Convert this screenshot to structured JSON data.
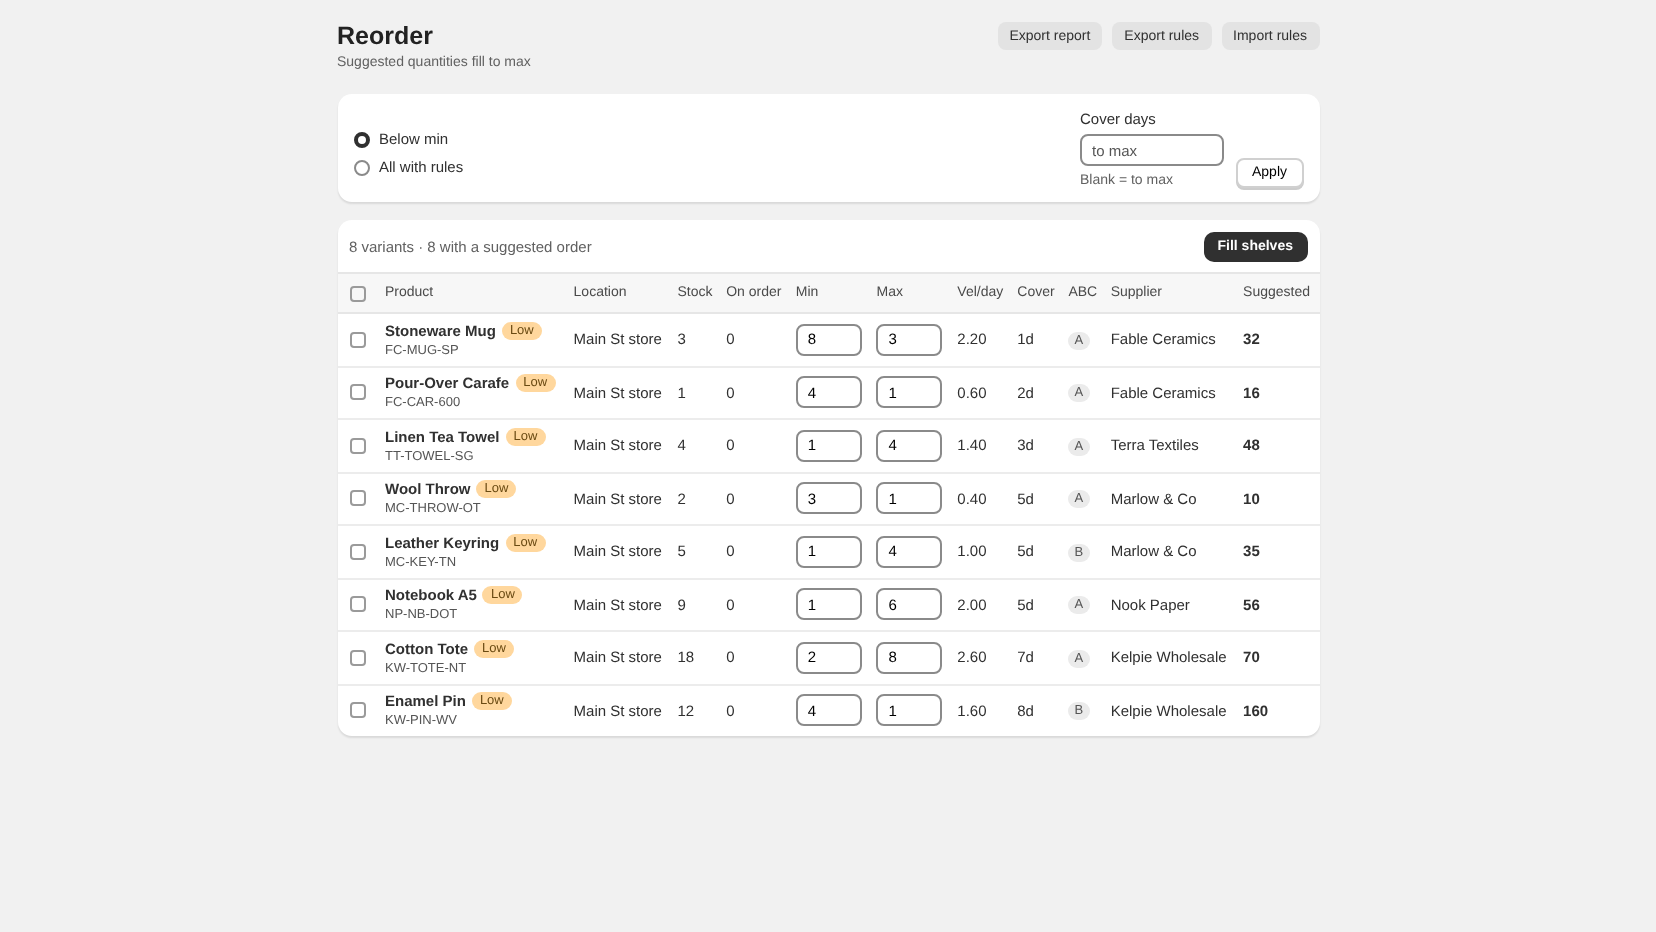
{
  "page": {
    "title": "Reorder",
    "subtitle": "Suggested quantities fill to max",
    "actions": [
      "Export report",
      "Export rules",
      "Import rules"
    ]
  },
  "filter": {
    "options": [
      {
        "label": "Below min",
        "selected": true
      },
      {
        "label": "All with rules",
        "selected": false
      }
    ],
    "cover_days": {
      "label": "Cover days",
      "placeholder": "to max",
      "help": "Blank = to max"
    },
    "apply": "Apply"
  },
  "table": {
    "summary": "8 variants · 8 with a suggested order",
    "fill_button": "Fill shelves",
    "select_all_checked": false,
    "columns": [
      "Product",
      "Location",
      "Stock",
      "On order",
      "Min",
      "Max",
      "Vel/day",
      "Cover",
      "ABC",
      "Supplier",
      "Suggested"
    ],
    "rows": [
      {
        "checked": false,
        "product": "Stoneware Mug",
        "badge": "Low",
        "sku": "FC-MUG-SP",
        "location": "Main St store",
        "stock": "3",
        "on_order": "0",
        "min": "8",
        "max": "3",
        "vel": "2.20",
        "cover": "1d",
        "abc": "A",
        "supplier": "Fable Ceramics",
        "suggested": "32"
      },
      {
        "checked": false,
        "product": "Pour-Over Carafe",
        "badge": "Low",
        "sku": "FC-CAR-600",
        "location": "Main St store",
        "stock": "1",
        "on_order": "0",
        "min": "4",
        "max": "1",
        "vel": "0.60",
        "cover": "2d",
        "abc": "A",
        "supplier": "Fable Ceramics",
        "suggested": "16"
      },
      {
        "checked": false,
        "product": "Linen Tea Towel",
        "badge": "Low",
        "sku": "TT-TOWEL-SG",
        "location": "Main St store",
        "stock": "4",
        "on_order": "0",
        "min": "1",
        "max": "4",
        "vel": "1.40",
        "cover": "3d",
        "abc": "A",
        "supplier": "Terra Textiles",
        "suggested": "48"
      },
      {
        "checked": false,
        "product": "Wool Throw",
        "badge": "Low",
        "sku": "MC-THROW-OT",
        "location": "Main St store",
        "stock": "2",
        "on_order": "0",
        "min": "3",
        "max": "1",
        "vel": "0.40",
        "cover": "5d",
        "abc": "A",
        "supplier": "Marlow & Co",
        "suggested": "10"
      },
      {
        "checked": false,
        "product": "Leather Keyring",
        "badge": "Low",
        "sku": "MC-KEY-TN",
        "location": "Main St store",
        "stock": "5",
        "on_order": "0",
        "min": "1",
        "max": "4",
        "vel": "1.00",
        "cover": "5d",
        "abc": "B",
        "supplier": "Marlow & Co",
        "suggested": "35"
      },
      {
        "checked": false,
        "product": "Notebook A5",
        "badge": "Low",
        "sku": "NP-NB-DOT",
        "location": "Main St store",
        "stock": "9",
        "on_order": "0",
        "min": "1",
        "max": "6",
        "vel": "2.00",
        "cover": "5d",
        "abc": "A",
        "supplier": "Nook Paper",
        "suggested": "56"
      },
      {
        "checked": false,
        "product": "Cotton Tote",
        "badge": "Low",
        "sku": "KW-TOTE-NT",
        "location": "Main St store",
        "stock": "18",
        "on_order": "0",
        "min": "2",
        "max": "8",
        "vel": "2.60",
        "cover": "7d",
        "abc": "A",
        "supplier": "Kelpie Wholesale",
        "suggested": "70"
      },
      {
        "checked": false,
        "product": "Enamel Pin",
        "badge": "Low",
        "sku": "KW-PIN-WV",
        "location": "Main St store",
        "stock": "12",
        "on_order": "0",
        "min": "4",
        "max": "1",
        "vel": "1.60",
        "cover": "8d",
        "abc": "B",
        "supplier": "Kelpie Wholesale",
        "suggested": "160"
      }
    ]
  }
}
